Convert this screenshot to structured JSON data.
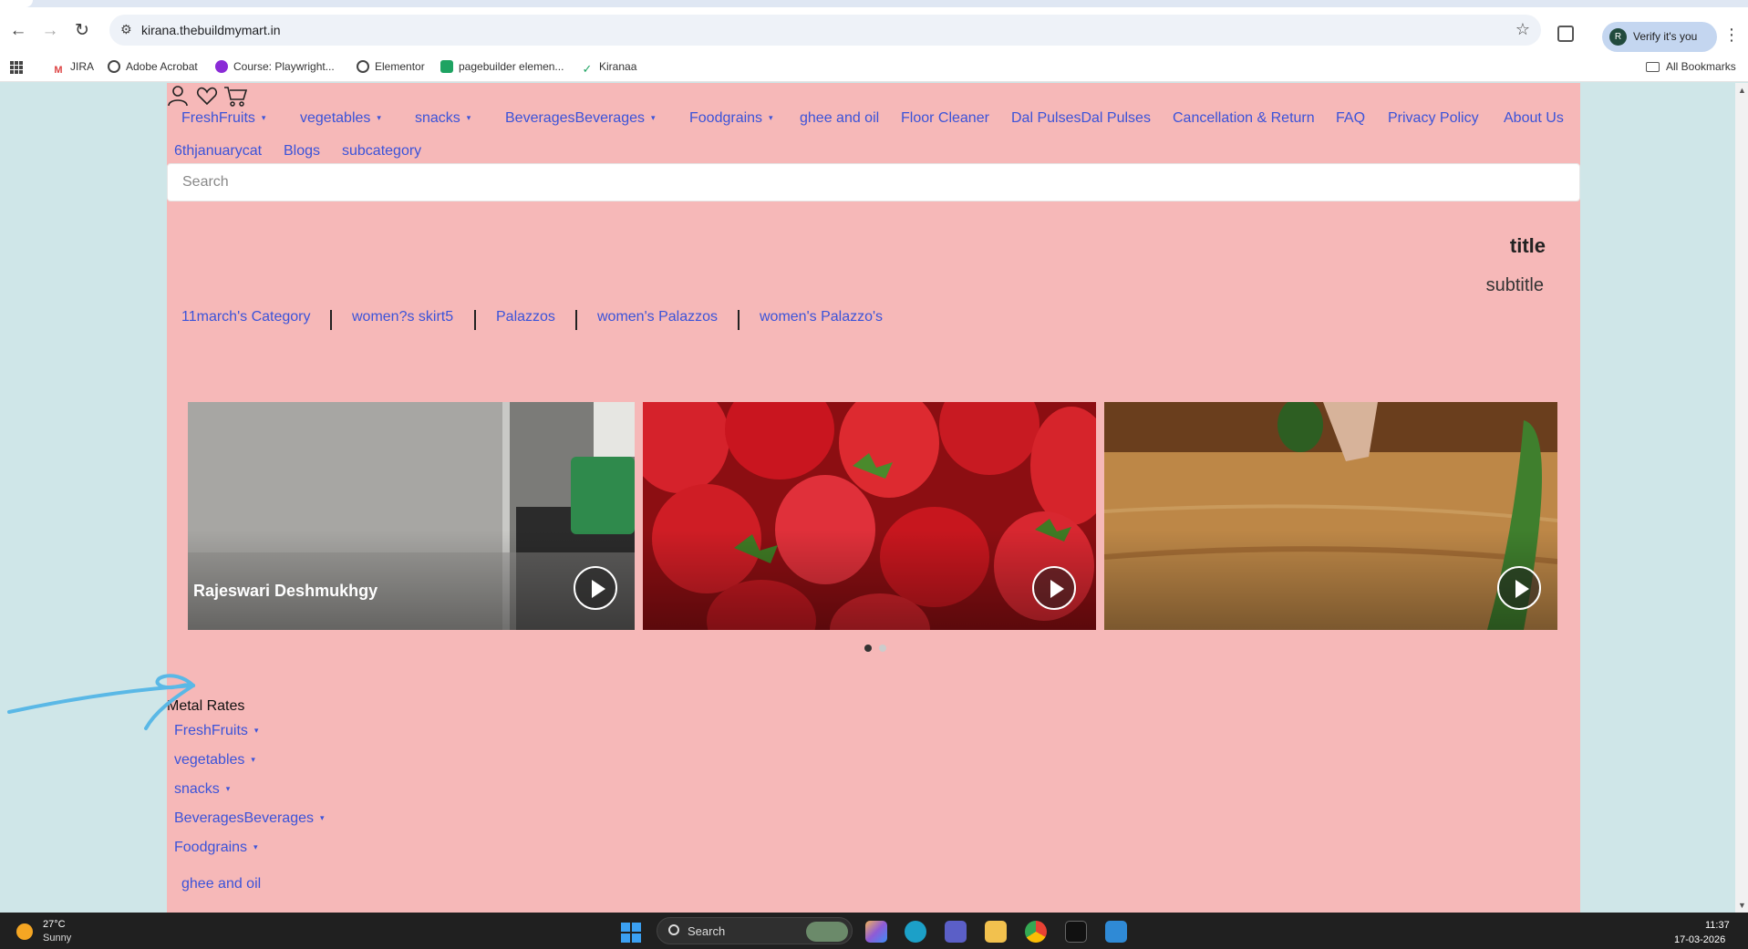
{
  "browser": {
    "url": "kirana.thebuildmymart.in",
    "profile_initial": "R",
    "profile_label": "Verify it's you",
    "bookmarks": [
      "JIRA",
      "Adobe Acrobat",
      "Course: Playwright...",
      "Elementor",
      "pagebuilder elemen...",
      "Kiranaa"
    ],
    "all_bookmarks_label": "All Bookmarks"
  },
  "nav": {
    "items": [
      {
        "label": "FreshFruits",
        "caret": "▾"
      },
      {
        "label": "vegetables",
        "caret": "▾"
      },
      {
        "label": "snacks",
        "caret": "▾"
      },
      {
        "label": "BeveragesBeverages",
        "caret": "▾"
      },
      {
        "label": "Foodgrains",
        "caret": "▾"
      },
      {
        "label": "ghee and oil"
      },
      {
        "label": "Floor Cleaner"
      },
      {
        "label": "Dal PulsesDal Pulses"
      },
      {
        "label": "Cancellation & Return"
      },
      {
        "label": "FAQ"
      },
      {
        "label": "Privacy Policy"
      },
      {
        "label": "About Us"
      }
    ],
    "items_row2": [
      "6thjanuarycat",
      "Blogs",
      "subcategory"
    ]
  },
  "search": {
    "placeholder": "Search"
  },
  "hero": {
    "title": "title",
    "subtitle": "subtitle"
  },
  "categories": [
    "11march's Category",
    "women?s skirt5",
    "Palazzos",
    "women's Palazzos",
    "women's Palazzo's"
  ],
  "videos": {
    "card1_caption": "Rajeswari Deshmukhgy",
    "carousel_dots": 2,
    "active_dot": 0
  },
  "sidebar": {
    "heading": "Metal Rates",
    "items": [
      {
        "label": "FreshFruits",
        "caret": "▾"
      },
      {
        "label": "vegetables",
        "caret": "▾"
      },
      {
        "label": "snacks",
        "caret": "▾"
      },
      {
        "label": "BeveragesBeverages",
        "caret": "▾"
      },
      {
        "label": "Foodgrains",
        "caret": "▾"
      },
      {
        "label": "ghee and oil"
      }
    ]
  },
  "taskbar": {
    "temperature": "27°C",
    "weather": "Sunny",
    "search_label": "Search",
    "time": "11:37",
    "date": "17-03-2026"
  },
  "colors": {
    "page_background": "#cfe6e8",
    "site_background": "#f6b8b8",
    "link": "#3b53d9",
    "annotation_arrow": "#5ab8e6"
  }
}
